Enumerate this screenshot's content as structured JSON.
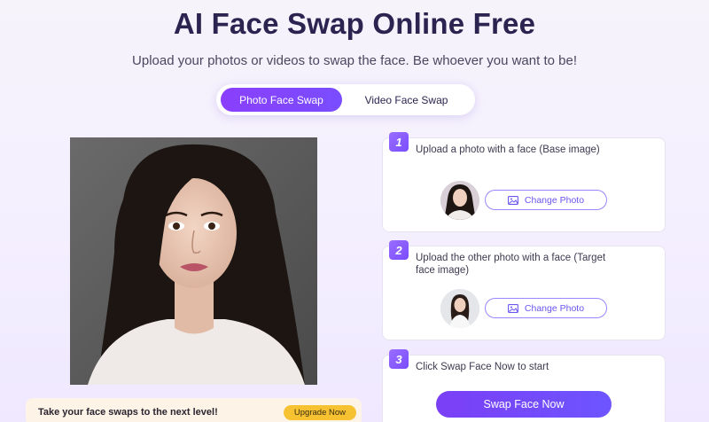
{
  "header": {
    "title": "AI Face Swap Online Free",
    "subtitle": "Upload your photos or videos to swap the face. Be whoever you want to be!"
  },
  "tabs": [
    {
      "label": "Photo Face Swap",
      "active": true
    },
    {
      "label": "Video Face Swap",
      "active": false
    }
  ],
  "banner": {
    "text": "Take your face swaps to the next level!",
    "button": "Upgrade Now"
  },
  "steps": [
    {
      "number": "1",
      "text": "Upload a photo with a face (Base image)",
      "button": "Change Photo"
    },
    {
      "number": "2",
      "text": "Upload the other photo with a face (Target face image)",
      "button": "Change Photo"
    },
    {
      "number": "3",
      "text": "Click Swap Face Now to start",
      "button": "Swap Face Now"
    }
  ],
  "colors": {
    "accent": "#7a4dff",
    "upgrade": "#f6c232",
    "banner_bg": "#fdf4e7"
  },
  "icons": {
    "change_photo": "image-icon"
  }
}
